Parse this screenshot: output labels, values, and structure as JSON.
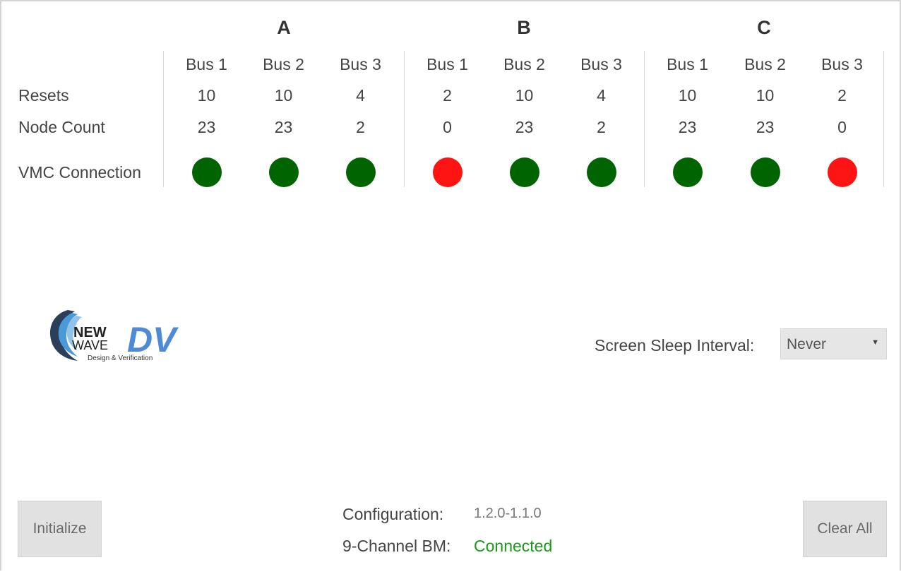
{
  "groups": [
    {
      "name": "A",
      "buses": [
        "Bus 1",
        "Bus 2",
        "Bus 3"
      ],
      "resets": [
        "10",
        "10",
        "4"
      ],
      "node_count": [
        "23",
        "23",
        "2"
      ],
      "vmc": [
        "green",
        "green",
        "green"
      ]
    },
    {
      "name": "B",
      "buses": [
        "Bus 1",
        "Bus 2",
        "Bus 3"
      ],
      "resets": [
        "2",
        "10",
        "4"
      ],
      "node_count": [
        "0",
        "23",
        "2"
      ],
      "vmc": [
        "red",
        "green",
        "green"
      ]
    },
    {
      "name": "C",
      "buses": [
        "Bus 1",
        "Bus 2",
        "Bus 3"
      ],
      "resets": [
        "10",
        "10",
        "2"
      ],
      "node_count": [
        "23",
        "23",
        "0"
      ],
      "vmc": [
        "green",
        "green",
        "red"
      ]
    }
  ],
  "rows": {
    "resets": "Resets",
    "node_count": "Node Count",
    "vmc": "VMC Connection"
  },
  "colors": {
    "green": "#006400",
    "red": "#ff1414",
    "connected": "#1a9a1a"
  },
  "logo": {
    "line1": "NEW",
    "line2": "WAVE",
    "mark": "DV",
    "tagline": "Design & Verification"
  },
  "sleep": {
    "label": "Screen Sleep Interval:",
    "value": "Never"
  },
  "buttons": {
    "initialize": "Initialize",
    "clear_all": "Clear All"
  },
  "info": {
    "configuration_label": "Configuration:",
    "configuration_value": "1.2.0-1.1.0",
    "bm_label": "9-Channel BM:",
    "bm_value": "Connected"
  }
}
